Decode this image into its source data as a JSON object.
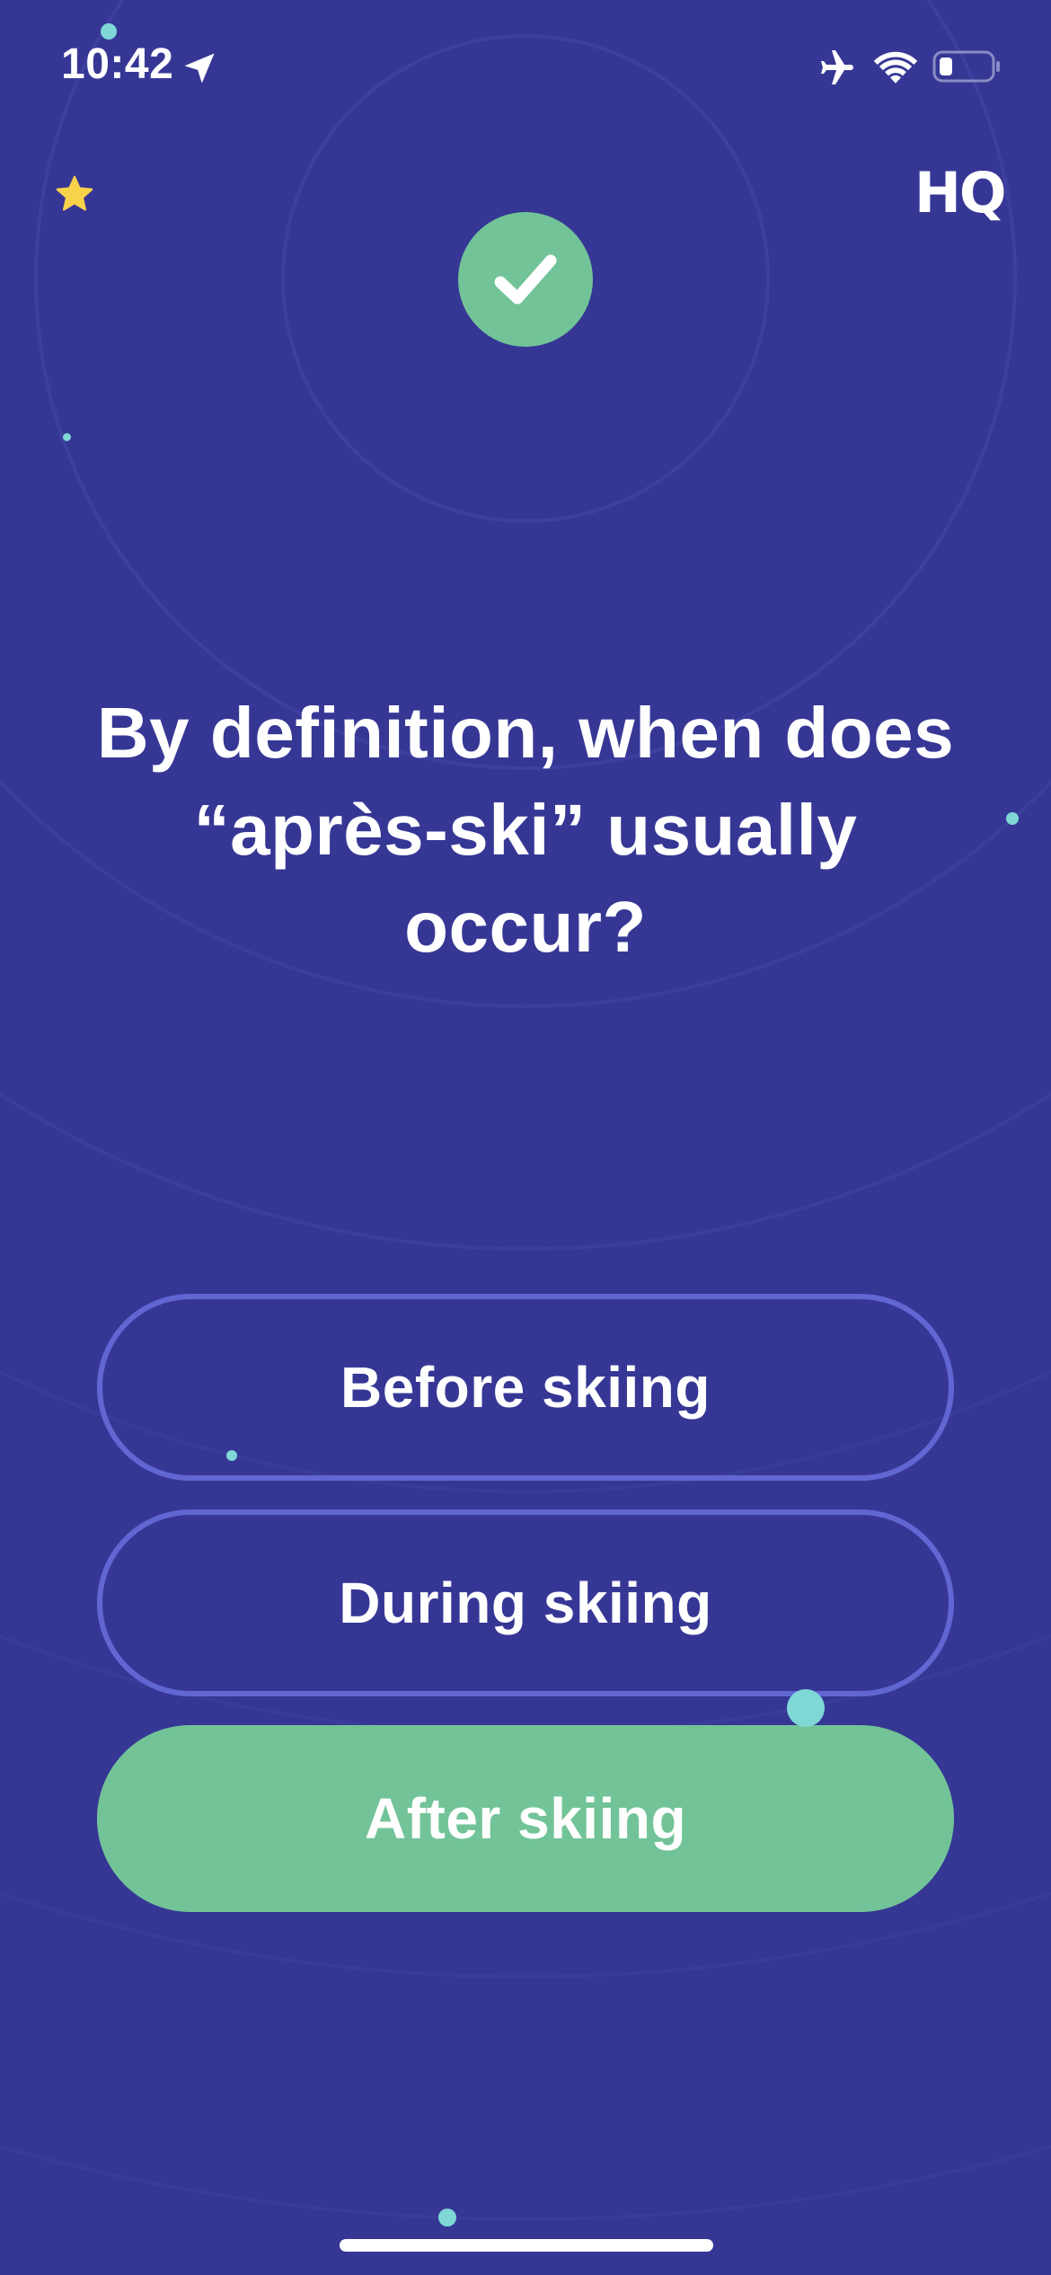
{
  "status_bar": {
    "time": "10:42"
  },
  "icons": {
    "location": "location-arrow-icon",
    "airplane": "airplane-mode-icon",
    "wifi": "wifi-icon",
    "battery": "battery-low-icon",
    "star": "star-icon",
    "check": "checkmark-icon"
  },
  "header": {
    "logo": "HQ"
  },
  "question": {
    "text": "By definition, when does “après-ski” usually occur?"
  },
  "answers": [
    {
      "label": "Before skiing",
      "state": "unselected"
    },
    {
      "label": "During skiing",
      "state": "unselected"
    },
    {
      "label": "After skiing",
      "state": "correct"
    }
  ],
  "colors": {
    "background": "#363795",
    "correct": "#72c498",
    "outline": "#6166d3",
    "star": "#f8d24b",
    "particle": "#7fd7d6"
  }
}
